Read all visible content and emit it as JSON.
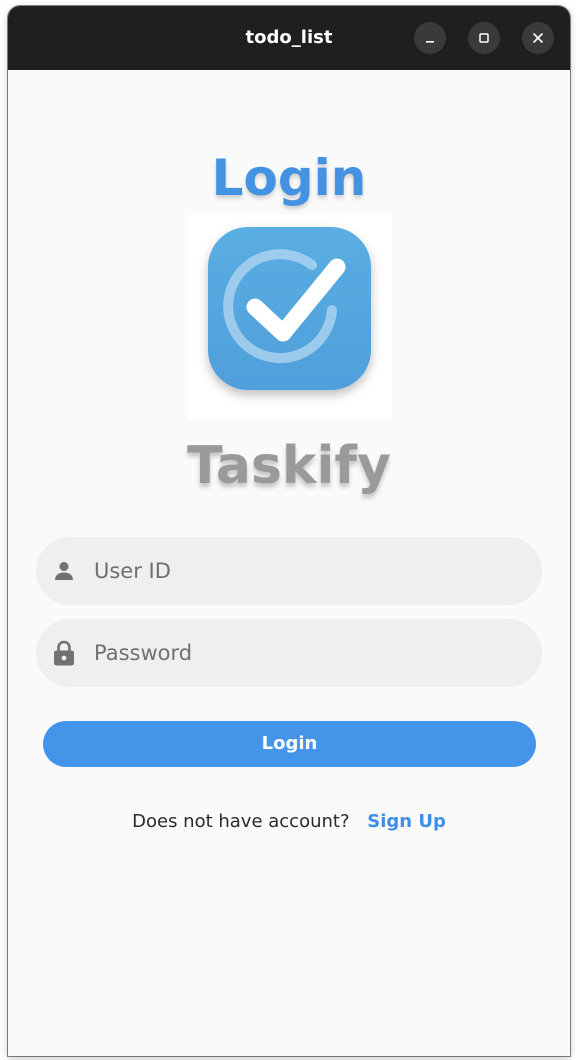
{
  "window": {
    "title": "todo_list"
  },
  "icons": {
    "minimize": "minimize-icon",
    "maximize": "maximize-icon",
    "close": "close-icon",
    "user": "person-icon",
    "password": "lock-icon",
    "logo": "checkmark-logo-icon"
  },
  "colors": {
    "accent": "#4493e3",
    "button": "#4495ea",
    "app_name": "#9a9a9a",
    "field_bg": "#efefef",
    "titlebar": "#1f1f1f"
  },
  "login": {
    "heading": "Login",
    "app_name": "Taskify",
    "user_id_placeholder": "User ID",
    "password_placeholder": "Password",
    "button_label": "Login",
    "signup_prompt": "Does not have account?",
    "signup_link": "Sign Up"
  }
}
